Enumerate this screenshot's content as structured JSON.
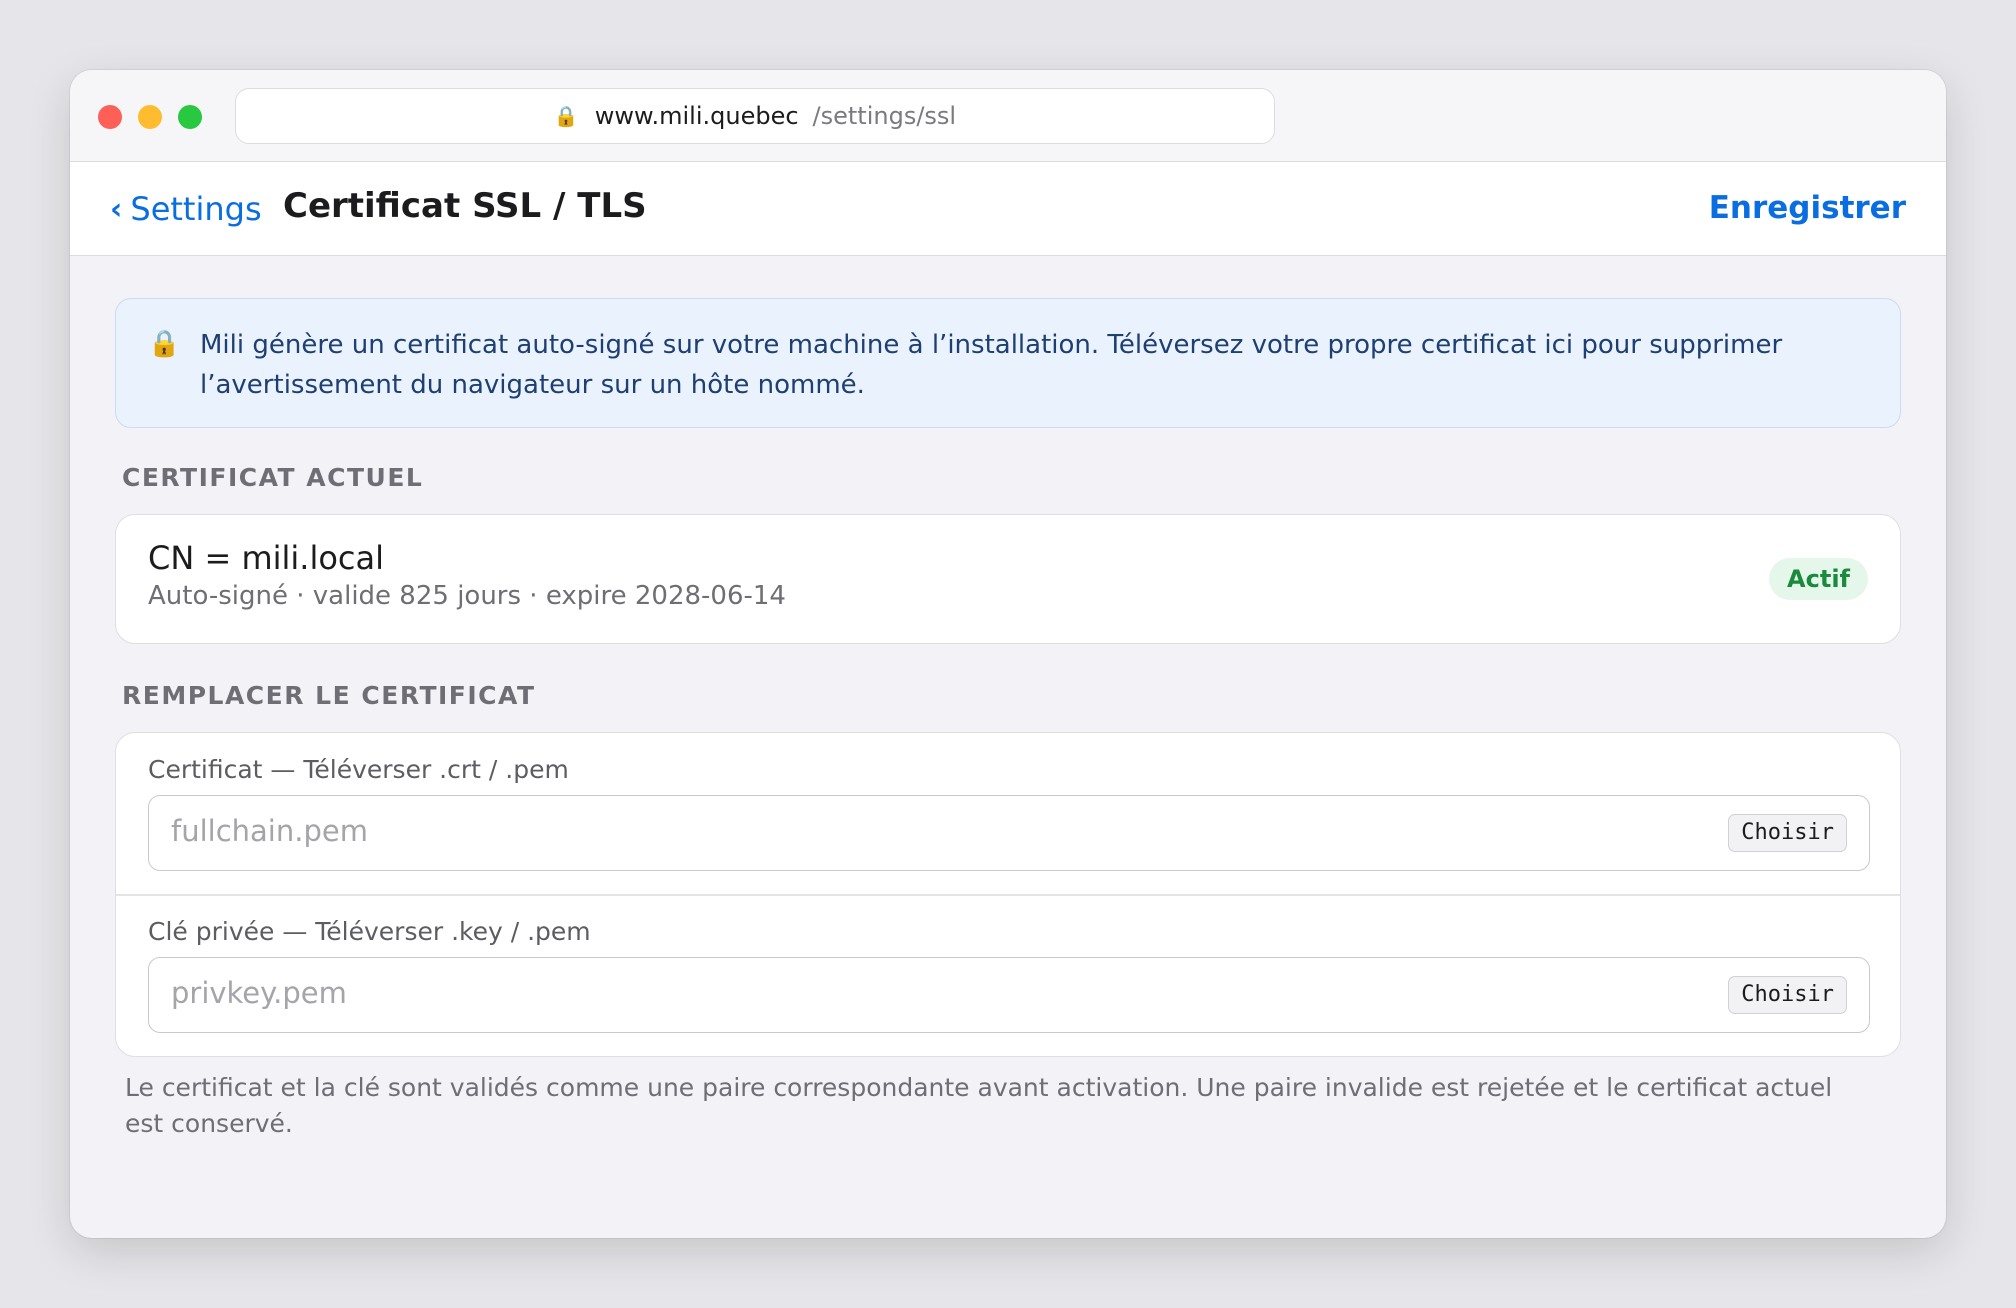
{
  "browser": {
    "url_host": "www.mili.quebec",
    "url_path": "/settings/ssl",
    "lock_icon": "lock-icon"
  },
  "navbar": {
    "back_label": "Settings",
    "title": "Certificat SSL / TLS",
    "save_label": "Enregistrer",
    "accent_color": "#0a6ee0"
  },
  "info": {
    "text": "Mili génère un certificat auto-signé sur votre machine à l’installation. Téléversez votre propre certificat ici pour supprimer l’avertissement du navigateur sur un hôte nommé."
  },
  "current": {
    "heading": "CERTIFICAT ACTUEL",
    "cn": "CN = mili.local",
    "details": "Auto-signé · valide 825 jours · expire 2028-06-14",
    "status": "Actif",
    "status_color": "#1a8a3c"
  },
  "replace": {
    "heading": "REMPLACER LE CERTIFICAT",
    "cert_label": "Certificat — Téléverser .crt / .pem",
    "cert_placeholder": "fullchain.pem",
    "cert_button": "Choisir",
    "key_label": "Clé privée — Téléverser .key / .pem",
    "key_placeholder": "privkey.pem",
    "key_button": "Choisir"
  },
  "footnote": "Le certificat et la clé sont validés comme une paire correspondante avant activation. Une paire invalide est rejetée et le certificat actuel est conservé."
}
